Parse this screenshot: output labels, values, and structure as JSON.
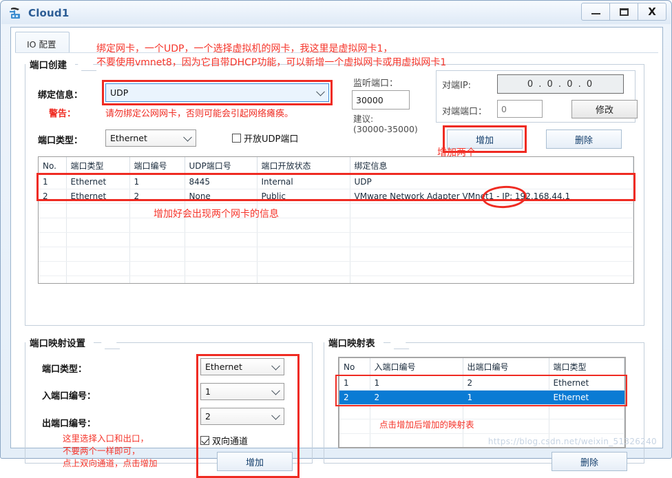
{
  "window": {
    "title": "Cloud1",
    "icon": "cloud-device-icon",
    "minimize_label": "–",
    "maximize_label": "□",
    "close_label": "X"
  },
  "tabs": [
    {
      "label": "IO 配置"
    }
  ],
  "port_create": {
    "group_title": "端口创建",
    "bind_info_label": "绑定信息：",
    "bind_info_value": "UDP",
    "warning_label": "警告：",
    "warning_text": "请勿绑定公网网卡，否则可能会引起网络瘫痪。",
    "port_type_label": "端口类型：",
    "port_type_value": "Ethernet",
    "open_udp_label": "开放UDP端口",
    "open_udp_checked": false,
    "listen_port_label": "监听端口：",
    "listen_port_value": "30000",
    "suggest_label": "建议:",
    "suggest_range": "(30000-35000)",
    "peer_ip_label": "对端IP:",
    "peer_ip_value": "0 . 0 . 0 . 0",
    "peer_port_label": "对端端口：",
    "peer_port_value": "0",
    "modify_button": "修改",
    "add_button": "增加",
    "delete_button": "删除"
  },
  "port_table": {
    "columns": [
      "No.",
      "端口类型",
      "端口编号",
      "UDP端口号",
      "端口开放状态",
      "绑定信息"
    ],
    "rows": [
      [
        "1",
        "Ethernet",
        "1",
        "8445",
        "Internal",
        "UDP"
      ],
      [
        "2",
        "Ethernet",
        "2",
        "None",
        "Public",
        "VMware Network Adapter VMnet1 - IP: 192.168.44.1"
      ]
    ],
    "empty_row_count": 6
  },
  "mapping_settings": {
    "group_title": "端口映射设置",
    "port_type_label": "端口类型：",
    "port_type_value": "Ethernet",
    "in_port_label": "入端口编号：",
    "in_port_value": "1",
    "out_port_label": "出端口编号：",
    "out_port_value": "2",
    "bidirectional_label": "双向通道",
    "bidirectional_checked": true,
    "add_button": "增加"
  },
  "mapping_table": {
    "group_title": "端口映射表",
    "columns": [
      "No",
      "入端口编号",
      "出端口编号",
      "端口类型"
    ],
    "rows": [
      {
        "cells": [
          "1",
          "1",
          "2",
          "Ethernet"
        ],
        "selected": false
      },
      {
        "cells": [
          "2",
          "2",
          "1",
          "Ethernet"
        ],
        "selected": true
      }
    ],
    "empty_row_count": 4,
    "delete_button": "删除"
  },
  "annotations": {
    "top": "绑定网卡，一个UDP，一个选择虚拟机的网卡，我这里是虚拟网卡1，\n不要使用vmnet8，因为它自带DHCP功能，可以新增一个虚拟网卡或用虚拟网卡1",
    "add_two": "增加两个",
    "table_hint": "增加好会出现两个网卡的信息",
    "mapping_hint": "这里选择入口和出口，\n不要两个一样即可，\n点上双向通道，点击增加",
    "mapping_table_hint": "点击增加后增加的映射表"
  },
  "watermark": "https://blog.csdn.net/weixin_51326240",
  "colors": {
    "annotation_red": "#f5352b",
    "selection_blue": "#0a7bd4",
    "title_blue": "#2c5d95"
  }
}
